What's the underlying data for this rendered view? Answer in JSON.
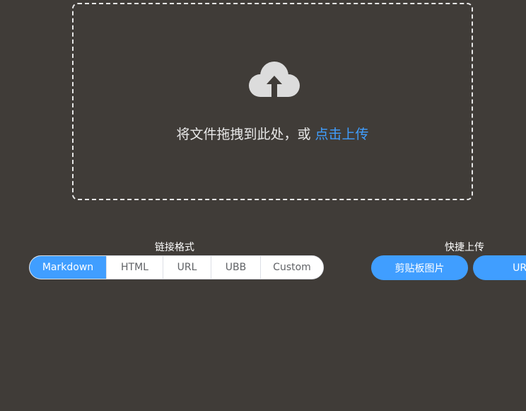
{
  "dropzone": {
    "prompt_text": "将文件拖拽到此处，或",
    "upload_link": "点击上传",
    "icon": "cloud-upload-icon"
  },
  "link_format": {
    "title": "链接格式",
    "options": [
      "Markdown",
      "HTML",
      "URL",
      "UBB",
      "Custom"
    ],
    "selected": "Markdown"
  },
  "quick_upload": {
    "title": "快捷上传",
    "clipboard_label": "剪贴板图片",
    "url_label": "URL"
  },
  "colors": {
    "background": "#403c38",
    "accent": "#409eff"
  }
}
